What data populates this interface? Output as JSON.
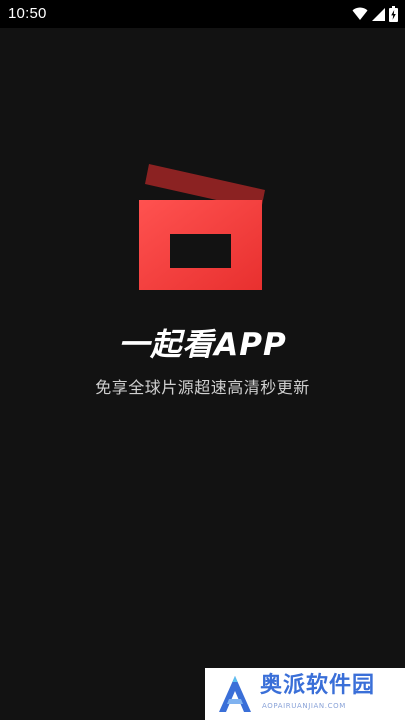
{
  "status_bar": {
    "time": "10:50",
    "icons": [
      "wifi-icon",
      "signal-icon",
      "battery-icon"
    ]
  },
  "splash": {
    "logo": "clapperboard-logo",
    "title": "一起看APP",
    "slogan": "免享全球片源超速高清秒更新"
  },
  "watermark": {
    "name": "奥派软件园",
    "url": "AOPAIRUANJIAN.COM"
  },
  "colors": {
    "background": "#121212",
    "status_bar": "#000000",
    "logo_red": "#f0413f",
    "logo_dark_red": "#8b2222",
    "watermark_blue": "#3a6fd8"
  }
}
